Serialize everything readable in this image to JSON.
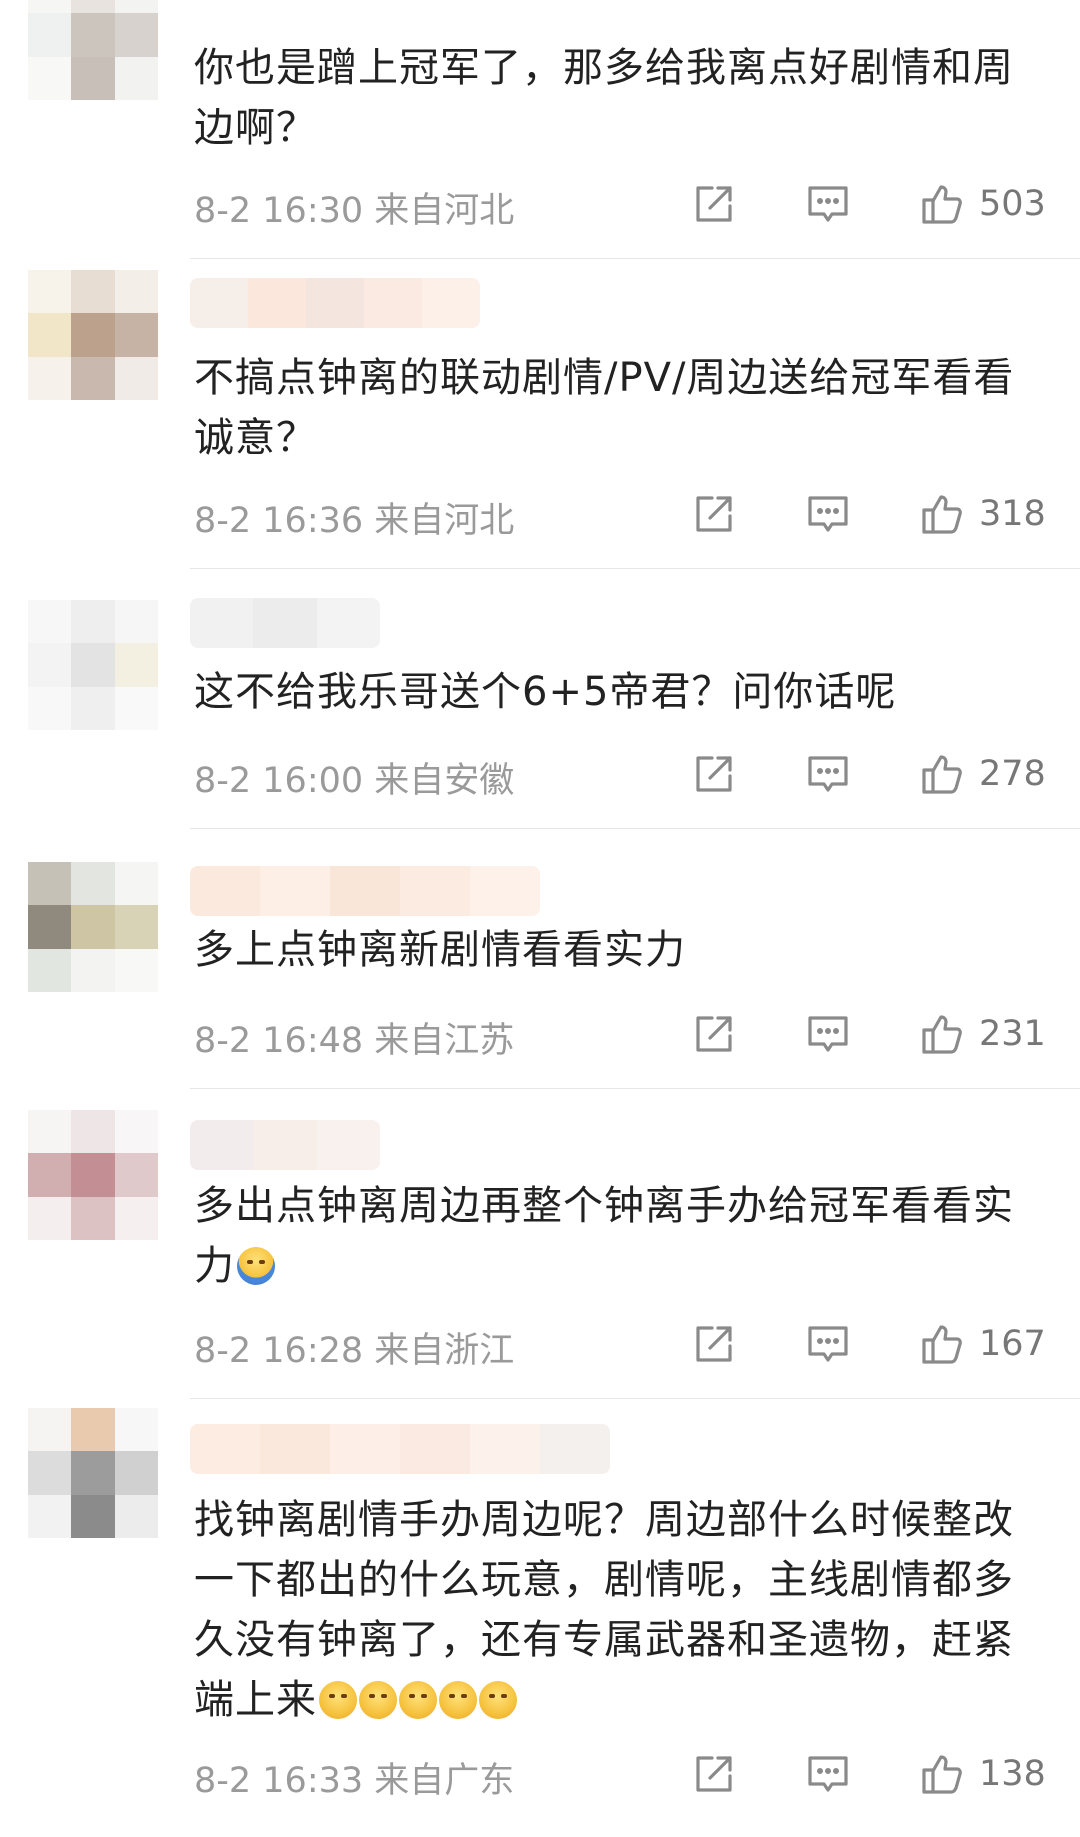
{
  "comments": [
    {
      "text": "你也是蹭上冠军了，那多给我离点好剧情和周边啊？",
      "emoji": "",
      "time": "8-2 16:30",
      "location": "来自河北",
      "likes": "503"
    },
    {
      "text": "不搞点钟离的联动剧情/PV/周边送给冠军看看诚意？",
      "emoji": "",
      "time": "8-2 16:36",
      "location": "来自河北",
      "likes": "318"
    },
    {
      "text": "这不给我乐哥送个6+5帝君？问你话呢",
      "emoji": "",
      "time": "8-2 16:00",
      "location": "来自安徽",
      "likes": "278"
    },
    {
      "text": "多上点钟离新剧情看看实力",
      "emoji": "",
      "time": "8-2 16:48",
      "location": "来自江苏",
      "likes": "231"
    },
    {
      "text": "多出点钟离周边再整个钟离手办给冠军看看实力",
      "emoji": "hug",
      "time": "8-2 16:28",
      "location": "来自浙江",
      "likes": "167"
    },
    {
      "text": "找钟离剧情手办周边呢？周边部什么时候整改一下都出的什么玩意，剧情呢，主线剧情都多久没有钟离了，还有专属武器和圣遗物，赶紧端上来",
      "emoji": "huffs",
      "time": "8-2 16:33",
      "location": "来自广东",
      "likes": "138"
    }
  ],
  "icons": {
    "share": "share-icon",
    "reply": "comment-icon",
    "like": "thumbs-up-icon"
  },
  "colors": {
    "meta_text": "#9a9a9a",
    "body_text": "#222222",
    "divider": "#e6e6e6"
  }
}
